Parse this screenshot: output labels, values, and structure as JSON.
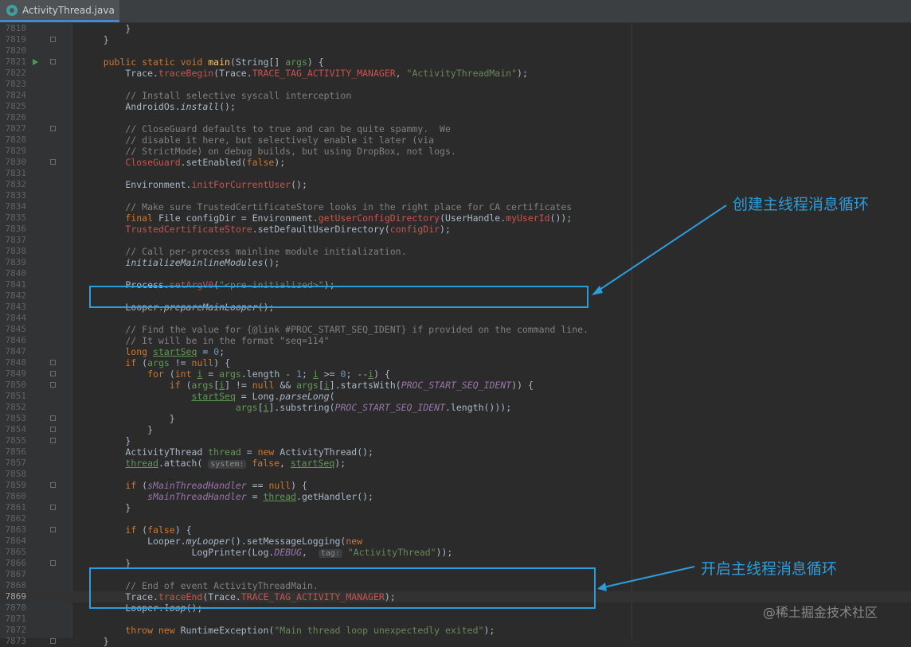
{
  "tab": {
    "label": "ActivityThread.java"
  },
  "annotations": {
    "create_loop": "创建主线程消息循环",
    "start_loop": "开启主线程消息循环"
  },
  "watermark": "@稀土掘金技术社区",
  "lines": [
    {
      "n": "7818",
      "code": [
        {
          "t": "        }",
          "c": ""
        }
      ]
    },
    {
      "n": "7819",
      "code": [
        {
          "t": "    }",
          "c": ""
        }
      ]
    },
    {
      "n": "7820",
      "code": []
    },
    {
      "n": "7821",
      "code": [
        {
          "t": "    public static void ",
          "c": "k"
        },
        {
          "t": "main",
          "c": "m"
        },
        {
          "t": "(String[] ",
          "c": ""
        },
        {
          "t": "args",
          "c": "gl"
        },
        {
          "t": ") {",
          "c": ""
        }
      ]
    },
    {
      "n": "7822",
      "code": [
        {
          "t": "        Trace.",
          "c": ""
        },
        {
          "t": "traceBegin",
          "c": "r"
        },
        {
          "t": "(Trace.",
          "c": ""
        },
        {
          "t": "TRACE_TAG_ACTIVITY_MANAGER",
          "c": "r"
        },
        {
          "t": ", ",
          "c": ""
        },
        {
          "t": "\"ActivityThreadMain\"",
          "c": "s"
        },
        {
          "t": ");",
          "c": ""
        }
      ]
    },
    {
      "n": "7823",
      "code": []
    },
    {
      "n": "7824",
      "code": [
        {
          "t": "        // Install selective syscall interception",
          "c": "c"
        }
      ]
    },
    {
      "n": "7825",
      "code": [
        {
          "t": "        AndroidOs.",
          "c": ""
        },
        {
          "t": "install",
          "c": "it"
        },
        {
          "t": "();",
          "c": ""
        }
      ]
    },
    {
      "n": "7826",
      "code": []
    },
    {
      "n": "7827",
      "code": [
        {
          "t": "        // CloseGuard defaults to true and can be quite spammy.  We",
          "c": "c"
        }
      ]
    },
    {
      "n": "7828",
      "code": [
        {
          "t": "        // disable it here, but selectively enable it later (via",
          "c": "c"
        }
      ]
    },
    {
      "n": "7829",
      "code": [
        {
          "t": "        // StrictMode) on debug builds, but using DropBox, not logs.",
          "c": "c"
        }
      ]
    },
    {
      "n": "7830",
      "code": [
        {
          "t": "        ",
          "c": ""
        },
        {
          "t": "CloseGuard",
          "c": "r"
        },
        {
          "t": ".setEnabled(",
          "c": ""
        },
        {
          "t": "false",
          "c": "k"
        },
        {
          "t": ");",
          "c": ""
        }
      ]
    },
    {
      "n": "7831",
      "code": []
    },
    {
      "n": "7832",
      "code": [
        {
          "t": "        Environment.",
          "c": ""
        },
        {
          "t": "initForCurrentUser",
          "c": "r"
        },
        {
          "t": "();",
          "c": ""
        }
      ]
    },
    {
      "n": "7833",
      "code": []
    },
    {
      "n": "7834",
      "code": [
        {
          "t": "        // Make sure TrustedCertificateStore looks in the right place for CA certificates",
          "c": "c"
        }
      ]
    },
    {
      "n": "7835",
      "code": [
        {
          "t": "        final ",
          "c": "k"
        },
        {
          "t": "File configDir = Environment.",
          "c": ""
        },
        {
          "t": "getUserConfigDirectory",
          "c": "r"
        },
        {
          "t": "(UserHandle.",
          "c": ""
        },
        {
          "t": "myUserId",
          "c": "r"
        },
        {
          "t": "());",
          "c": ""
        }
      ]
    },
    {
      "n": "7836",
      "code": [
        {
          "t": "        ",
          "c": ""
        },
        {
          "t": "TrustedCertificateStore",
          "c": "r"
        },
        {
          "t": ".setDefaultUserDirectory(",
          "c": ""
        },
        {
          "t": "configDir",
          "c": "r"
        },
        {
          "t": ");",
          "c": ""
        }
      ]
    },
    {
      "n": "7837",
      "code": []
    },
    {
      "n": "7838",
      "code": [
        {
          "t": "        // Call per-process mainline module initialization.",
          "c": "c"
        }
      ]
    },
    {
      "n": "7839",
      "code": [
        {
          "t": "        ",
          "c": ""
        },
        {
          "t": "initializeMainlineModules",
          "c": "it"
        },
        {
          "t": "();",
          "c": ""
        }
      ]
    },
    {
      "n": "7840",
      "code": []
    },
    {
      "n": "7841",
      "code": [
        {
          "t": "        Process.",
          "c": ""
        },
        {
          "t": "setArgV0",
          "c": "r"
        },
        {
          "t": "(",
          "c": ""
        },
        {
          "t": "\"<pre-initialized>\"",
          "c": "s"
        },
        {
          "t": ");",
          "c": ""
        }
      ]
    },
    {
      "n": "7842",
      "code": []
    },
    {
      "n": "7843",
      "code": [
        {
          "t": "        Looper.",
          "c": ""
        },
        {
          "t": "prepareMainLooper",
          "c": "it"
        },
        {
          "t": "();",
          "c": ""
        }
      ]
    },
    {
      "n": "7844",
      "code": []
    },
    {
      "n": "7845",
      "code": [
        {
          "t": "        // Find the value for {@link #PROC_START_SEQ_IDENT} if provided on the command line.",
          "c": "c"
        }
      ]
    },
    {
      "n": "7846",
      "code": [
        {
          "t": "        // It will be in the format \"seq=114\"",
          "c": "c"
        }
      ]
    },
    {
      "n": "7847",
      "code": [
        {
          "t": "        long ",
          "c": "k"
        },
        {
          "t": "startSeq",
          "c": "gu"
        },
        {
          "t": " = ",
          "c": ""
        },
        {
          "t": "0",
          "c": "n"
        },
        {
          "t": ";",
          "c": ""
        }
      ]
    },
    {
      "n": "7848",
      "code": [
        {
          "t": "        if ",
          "c": "k"
        },
        {
          "t": "(",
          "c": ""
        },
        {
          "t": "args",
          "c": "gl"
        },
        {
          "t": " != ",
          "c": ""
        },
        {
          "t": "null",
          "c": "k"
        },
        {
          "t": ") {",
          "c": ""
        }
      ]
    },
    {
      "n": "7849",
      "code": [
        {
          "t": "            for ",
          "c": "k"
        },
        {
          "t": "(",
          "c": ""
        },
        {
          "t": "int ",
          "c": "k"
        },
        {
          "t": "i",
          "c": "gu"
        },
        {
          "t": " = ",
          "c": ""
        },
        {
          "t": "args",
          "c": "gl"
        },
        {
          "t": ".length - ",
          "c": ""
        },
        {
          "t": "1",
          "c": "n"
        },
        {
          "t": "; ",
          "c": ""
        },
        {
          "t": "i",
          "c": "gu"
        },
        {
          "t": " >= ",
          "c": ""
        },
        {
          "t": "0",
          "c": "n"
        },
        {
          "t": "; --",
          "c": ""
        },
        {
          "t": "i",
          "c": "gu"
        },
        {
          "t": ") {",
          "c": ""
        }
      ]
    },
    {
      "n": "7850",
      "code": [
        {
          "t": "                if ",
          "c": "k"
        },
        {
          "t": "(",
          "c": ""
        },
        {
          "t": "args",
          "c": "gl"
        },
        {
          "t": "[",
          "c": ""
        },
        {
          "t": "i",
          "c": "gu"
        },
        {
          "t": "] != ",
          "c": ""
        },
        {
          "t": "null ",
          "c": "k"
        },
        {
          "t": "&& ",
          "c": ""
        },
        {
          "t": "args",
          "c": "gl"
        },
        {
          "t": "[",
          "c": ""
        },
        {
          "t": "i",
          "c": "gu"
        },
        {
          "t": "].startsWith(",
          "c": ""
        },
        {
          "t": "PROC_START_SEQ_IDENT",
          "c": "fi"
        },
        {
          "t": ")) {",
          "c": ""
        }
      ]
    },
    {
      "n": "7851",
      "code": [
        {
          "t": "                    ",
          "c": ""
        },
        {
          "t": "startSeq",
          "c": "gu"
        },
        {
          "t": " = Long.",
          "c": ""
        },
        {
          "t": "parseLong",
          "c": "it"
        },
        {
          "t": "(",
          "c": ""
        }
      ]
    },
    {
      "n": "7852",
      "code": [
        {
          "t": "                            ",
          "c": ""
        },
        {
          "t": "args",
          "c": "gl"
        },
        {
          "t": "[",
          "c": ""
        },
        {
          "t": "i",
          "c": "gu"
        },
        {
          "t": "].substring(",
          "c": ""
        },
        {
          "t": "PROC_START_SEQ_IDENT",
          "c": "fi"
        },
        {
          "t": ".length()));",
          "c": ""
        }
      ]
    },
    {
      "n": "7853",
      "code": [
        {
          "t": "                }",
          "c": ""
        }
      ]
    },
    {
      "n": "7854",
      "code": [
        {
          "t": "            }",
          "c": ""
        }
      ]
    },
    {
      "n": "7855",
      "code": [
        {
          "t": "        }",
          "c": ""
        }
      ]
    },
    {
      "n": "7856",
      "code": [
        {
          "t": "        ActivityThread ",
          "c": ""
        },
        {
          "t": "thread",
          "c": "gl"
        },
        {
          "t": " = ",
          "c": ""
        },
        {
          "t": "new ",
          "c": "k"
        },
        {
          "t": "ActivityThread();",
          "c": ""
        }
      ]
    },
    {
      "n": "7857",
      "code": [
        {
          "t": "        ",
          "c": ""
        },
        {
          "t": "thread",
          "c": "gu"
        },
        {
          "t": ".attach( ",
          "c": ""
        },
        {
          "t": "system:",
          "c": "hint"
        },
        {
          "t": " ",
          "c": ""
        },
        {
          "t": "false",
          "c": "k"
        },
        {
          "t": ", ",
          "c": ""
        },
        {
          "t": "startSeq",
          "c": "gu"
        },
        {
          "t": ");",
          "c": ""
        }
      ]
    },
    {
      "n": "7858",
      "code": []
    },
    {
      "n": "7859",
      "code": [
        {
          "t": "        if ",
          "c": "k"
        },
        {
          "t": "(",
          "c": ""
        },
        {
          "t": "sMainThreadHandler",
          "c": "fi"
        },
        {
          "t": " == ",
          "c": ""
        },
        {
          "t": "null",
          "c": "k"
        },
        {
          "t": ") {",
          "c": ""
        }
      ]
    },
    {
      "n": "7860",
      "code": [
        {
          "t": "            ",
          "c": ""
        },
        {
          "t": "sMainThreadHandler",
          "c": "fi"
        },
        {
          "t": " = ",
          "c": ""
        },
        {
          "t": "thread",
          "c": "gu"
        },
        {
          "t": ".getHandler();",
          "c": ""
        }
      ]
    },
    {
      "n": "7861",
      "code": [
        {
          "t": "        }",
          "c": ""
        }
      ]
    },
    {
      "n": "7862",
      "code": []
    },
    {
      "n": "7863",
      "code": [
        {
          "t": "        if ",
          "c": "k"
        },
        {
          "t": "(",
          "c": ""
        },
        {
          "t": "false",
          "c": "k"
        },
        {
          "t": ") {",
          "c": ""
        }
      ]
    },
    {
      "n": "7864",
      "code": [
        {
          "t": "            Looper.",
          "c": ""
        },
        {
          "t": "myLooper",
          "c": "it"
        },
        {
          "t": "().setMessageLogging(",
          "c": ""
        },
        {
          "t": "new",
          "c": "k"
        }
      ]
    },
    {
      "n": "7865",
      "code": [
        {
          "t": "                    LogPrinter(Log.",
          "c": ""
        },
        {
          "t": "DEBUG",
          "c": "fi"
        },
        {
          "t": ",  ",
          "c": ""
        },
        {
          "t": "tag:",
          "c": "hint"
        },
        {
          "t": " ",
          "c": ""
        },
        {
          "t": "\"ActivityThread\"",
          "c": "s"
        },
        {
          "t": "));",
          "c": ""
        }
      ]
    },
    {
      "n": "7866",
      "code": [
        {
          "t": "        }",
          "c": ""
        }
      ]
    },
    {
      "n": "7867",
      "code": []
    },
    {
      "n": "7868",
      "code": [
        {
          "t": "        // End of event ActivityThreadMain.",
          "c": "c"
        }
      ]
    },
    {
      "n": "7869",
      "code": [
        {
          "t": "        Trace.",
          "c": ""
        },
        {
          "t": "traceEnd",
          "c": "r"
        },
        {
          "t": "(Trace.",
          "c": ""
        },
        {
          "t": "TRACE_TAG_ACTIVITY_MANAGER",
          "c": "r"
        },
        {
          "t": ");",
          "c": ""
        }
      ],
      "current": true
    },
    {
      "n": "7870",
      "code": [
        {
          "t": "        Looper.",
          "c": ""
        },
        {
          "t": "loop",
          "c": "it"
        },
        {
          "t": "();",
          "c": ""
        }
      ]
    },
    {
      "n": "7871",
      "code": []
    },
    {
      "n": "7872",
      "code": [
        {
          "t": "        throw new ",
          "c": "k"
        },
        {
          "t": "RuntimeException(",
          "c": ""
        },
        {
          "t": "\"Main thread loop unexpectedly exited\"",
          "c": "s"
        },
        {
          "t": ");",
          "c": ""
        }
      ]
    },
    {
      "n": "7873",
      "code": [
        {
          "t": "    }",
          "c": ""
        }
      ]
    }
  ],
  "colors": {
    "annotation": "#2d9cdb",
    "keyword": "#cc7832",
    "string": "#6a8759",
    "comment": "#808080",
    "background": "#2b2b2b"
  }
}
